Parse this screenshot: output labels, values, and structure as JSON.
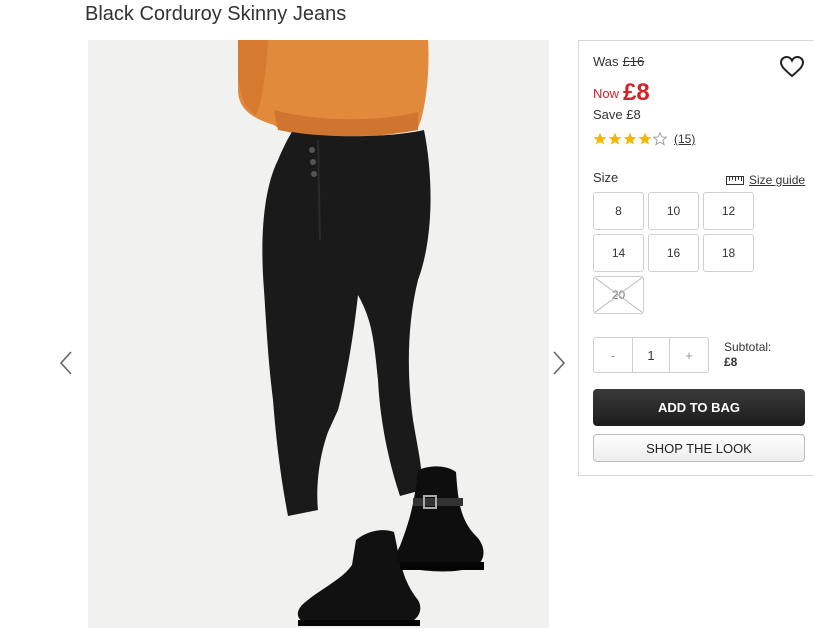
{
  "product": {
    "title": "Black Corduroy Skinny Jeans"
  },
  "gallery": {
    "prev_icon": "chevron-left-icon",
    "next_icon": "chevron-right-icon"
  },
  "pricing": {
    "was_label": "Was",
    "was_price": "£16",
    "now_label": "Now",
    "now_price": "£8",
    "save_text": "Save £8",
    "accent_color": "#d2232a"
  },
  "rating": {
    "stars": 4,
    "max_stars": 5,
    "review_count": "(15)"
  },
  "size": {
    "label": "Size",
    "guide_label": "Size guide",
    "options": [
      {
        "label": "8",
        "available": true
      },
      {
        "label": "10",
        "available": true
      },
      {
        "label": "12",
        "available": true
      },
      {
        "label": "14",
        "available": true
      },
      {
        "label": "16",
        "available": true
      },
      {
        "label": "18",
        "available": true
      },
      {
        "label": "20",
        "available": false
      }
    ]
  },
  "quantity": {
    "minus": "-",
    "value": "1",
    "plus": "+"
  },
  "subtotal": {
    "label": "Subtotal:",
    "amount": "£8"
  },
  "actions": {
    "add_to_bag": "ADD TO BAG",
    "shop_the_look": "SHOP THE LOOK"
  }
}
